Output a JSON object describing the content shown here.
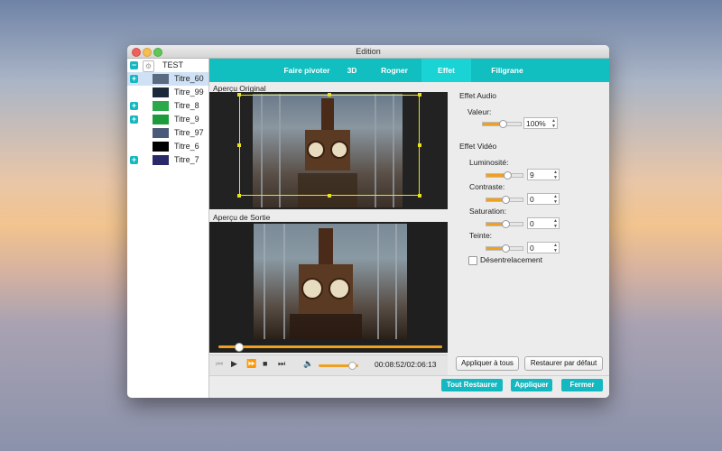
{
  "window": {
    "title": "Edition"
  },
  "sidebar": {
    "root": {
      "label": "TEST"
    },
    "items": [
      {
        "label": "Titre_60",
        "has_expand": true,
        "selected": true,
        "thumb": "#5a6a80"
      },
      {
        "label": "Titre_99",
        "has_expand": false,
        "selected": false,
        "thumb": "#1a2a3a"
      },
      {
        "label": "Titre_8",
        "has_expand": true,
        "selected": false,
        "thumb": "#2aa84a"
      },
      {
        "label": "Titre_9",
        "has_expand": true,
        "selected": false,
        "thumb": "#1c9a3c"
      },
      {
        "label": "Titre_97",
        "has_expand": false,
        "selected": false,
        "thumb": "#4a5a7a"
      },
      {
        "label": "Titre_6",
        "has_expand": false,
        "selected": false,
        "thumb": "#000000"
      },
      {
        "label": "Titre_7",
        "has_expand": true,
        "selected": false,
        "thumb": "#2a2a6a"
      }
    ]
  },
  "tabs": [
    {
      "label": "Faire pivoter",
      "active": false
    },
    {
      "label": "3D",
      "active": false
    },
    {
      "label": "Rogner",
      "active": false
    },
    {
      "label": "Effet",
      "active": true
    },
    {
      "label": "Filigrane",
      "active": false
    }
  ],
  "preview": {
    "original_label": "Aperçu Original",
    "output_label": "Aperçu de Sortie",
    "timecode": "00:08:52/02:06:13",
    "seek_progress": 0.09,
    "volume_level": 0.85
  },
  "effects": {
    "audio_title": "Effet Audio",
    "volume_label": "Valeur:",
    "volume_value": "100%",
    "video_title": "Effet Vidéo",
    "brightness_label": "Luminosité:",
    "brightness_value": "9",
    "contrast_label": "Contraste:",
    "contrast_value": "0",
    "saturation_label": "Saturation:",
    "saturation_value": "0",
    "hue_label": "Teinte:",
    "hue_value": "0",
    "deinterlace_label": "Désentrelacement"
  },
  "buttons": {
    "apply_all": "Appliquer à tous",
    "restore_default": "Restaurer par défaut",
    "restore_all": "Tout Restaurer",
    "apply": "Appliquer",
    "close": "Fermer"
  },
  "colors": {
    "accent": "#11bfc0",
    "slider": "#f0a020",
    "selection": "#cfe1f5"
  }
}
